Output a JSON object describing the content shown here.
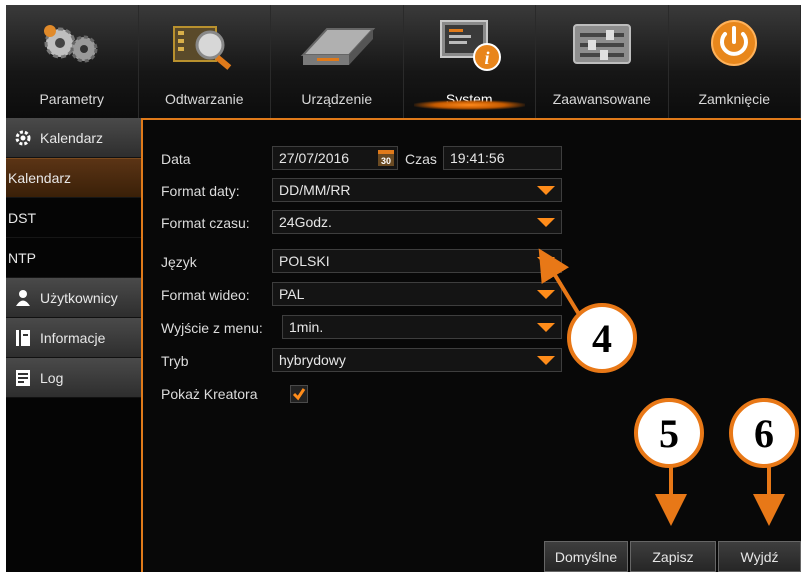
{
  "topnav": {
    "tabs": [
      {
        "label": "Parametry",
        "icon": "gears-icon",
        "active": false
      },
      {
        "label": "Odtwarzanie",
        "icon": "film-magnifier-icon",
        "active": false
      },
      {
        "label": "Urządzenie",
        "icon": "hard-drive-icon",
        "active": false
      },
      {
        "label": "System",
        "icon": "system-info-icon",
        "active": true
      },
      {
        "label": "Zaawansowane",
        "icon": "sliders-icon",
        "active": false
      },
      {
        "label": "Zamknięcie",
        "icon": "power-icon",
        "active": false
      }
    ]
  },
  "sidebar": {
    "calendar_header": "Kalendarz",
    "sub_items": [
      {
        "label": "Kalendarz",
        "active": true
      },
      {
        "label": "DST",
        "active": false
      },
      {
        "label": "NTP",
        "active": false
      }
    ],
    "users_header": "Użytkownicy",
    "info_header": "Informacje",
    "log_header": "Log"
  },
  "form": {
    "date_label": "Data",
    "date_value": "27/07/2016",
    "calendar_badge": "30",
    "time_label": "Czas",
    "time_value": "19:41:56",
    "date_format_label": "Format daty:",
    "date_format_value": "DD/MM/RR",
    "time_format_label": "Format czasu:",
    "time_format_value": "24Godz.",
    "language_label": "Język",
    "language_value": "POLSKI",
    "video_format_label": "Format wideo:",
    "video_format_value": "PAL",
    "menu_exit_label": "Wyjście z menu:",
    "menu_exit_value": "1min.",
    "mode_label": "Tryb",
    "mode_value": "hybrydowy",
    "show_wizard_label": "Pokaż Kreatora",
    "show_wizard_checked": true
  },
  "buttons": {
    "default_label": "Domyślne",
    "save_label": "Zapisz",
    "exit_label": "Wyjdź"
  },
  "annotations": {
    "callout_4": "4",
    "callout_5": "5",
    "callout_6": "6",
    "accent_color": "#e87817"
  }
}
